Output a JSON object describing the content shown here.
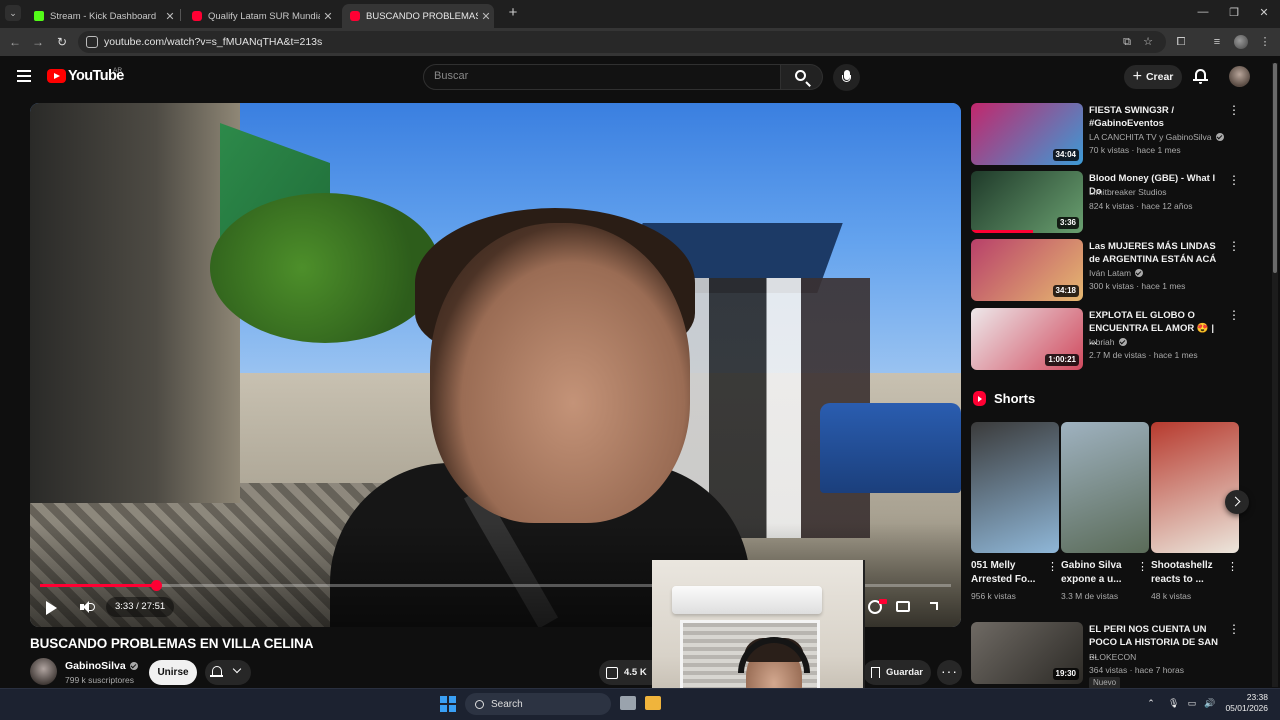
{
  "browser": {
    "tabs": [
      {
        "label": "Stream - Kick Dashboard",
        "icon": "kick-icon",
        "active": false
      },
      {
        "label": "Qualify Latam SUR Mundial Wa",
        "icon": "youtube-icon",
        "active": false
      },
      {
        "label": "BUSCANDO PROBLEMAS EN VI",
        "icon": "youtube-icon",
        "active": true
      }
    ],
    "url": "youtube.com/watch?v=s_fMUANqTHA&t=213s"
  },
  "masthead": {
    "logo_text": "YouTube",
    "country_code": "AR",
    "search_placeholder": "Buscar",
    "create_label": "Crear"
  },
  "player": {
    "current_time": "3:33",
    "duration": "27:51",
    "time_display": "3:33 / 27:51",
    "progress_fraction": 0.1275,
    "colors": {
      "accent": "#ff0033"
    }
  },
  "video": {
    "title": "BUSCANDO PROBLEMAS EN VILLA CELINA",
    "channel": "GabinoSilva",
    "subscribers": "799 k suscriptores",
    "join_label": "Unirse",
    "likes": "4.5 K",
    "save_label": "Guardar"
  },
  "sidebar": {
    "recommendations": [
      {
        "title": "FIESTA SWING3R / #GabinoEventos",
        "channel": "LA CANCHITA TV y GabinoSilva",
        "verified": true,
        "meta": "70 k vistas · hace 1 mes",
        "duration": "34:04",
        "thumb_colors": [
          "#c2276c",
          "#3c9bd6"
        ]
      },
      {
        "title": "Blood Money (GBE) - What I Do",
        "channel": "Limitbreaker Studios",
        "verified": false,
        "meta": "824 k vistas · hace 12 años",
        "duration": "3:36",
        "watched_fraction": 0.55,
        "thumb_colors": [
          "#1f3a2a",
          "#6aa070"
        ]
      },
      {
        "title": "Las MUJERES MÁS LINDAS de ARGENTINA ESTÁN ACÁ",
        "channel": "Iván Latam",
        "verified": true,
        "meta": "300 k vistas · hace 1 mes",
        "duration": "34:18",
        "thumb_colors": [
          "#b8406a",
          "#e6b870"
        ]
      },
      {
        "title": "EXPLOTA EL GLOBO O ENCUENTRA EL AMOR 😍 | ...",
        "channel": "lebriah",
        "verified": true,
        "meta": "2.7 M de vistas · hace 1 mes",
        "duration": "1:00:21",
        "thumb_colors": [
          "#ede8ea",
          "#d04a5e"
        ]
      },
      {
        "title": "EL PERI NOS CUENTA UN POCO LA HISTORIA DE SAN ...",
        "channel": "BLOKECON",
        "verified": false,
        "meta": "364 vistas · hace 7 horas",
        "duration": "19:30",
        "badge": "Nuevo",
        "thumb_colors": [
          "#6f6a64",
          "#2c2a26"
        ]
      }
    ],
    "shorts_label": "Shorts",
    "shorts": [
      {
        "title": "051 Melly Arrested Fo...",
        "views": "956 k vistas",
        "thumb_colors": [
          "#3b3b3b",
          "#8fb7d8"
        ]
      },
      {
        "title": "Gabino Silva expone a u...",
        "views": "3.3 M de vistas",
        "thumb_colors": [
          "#9fb2c0",
          "#5a6b58"
        ]
      },
      {
        "title": "Shootashellz reacts to ...",
        "views": "48 k vistas",
        "thumb_colors": [
          "#b73a2e",
          "#ece6dc"
        ]
      }
    ]
  },
  "taskbar": {
    "search_label": "Search",
    "time": "23:38",
    "date": "05/01/2026"
  }
}
